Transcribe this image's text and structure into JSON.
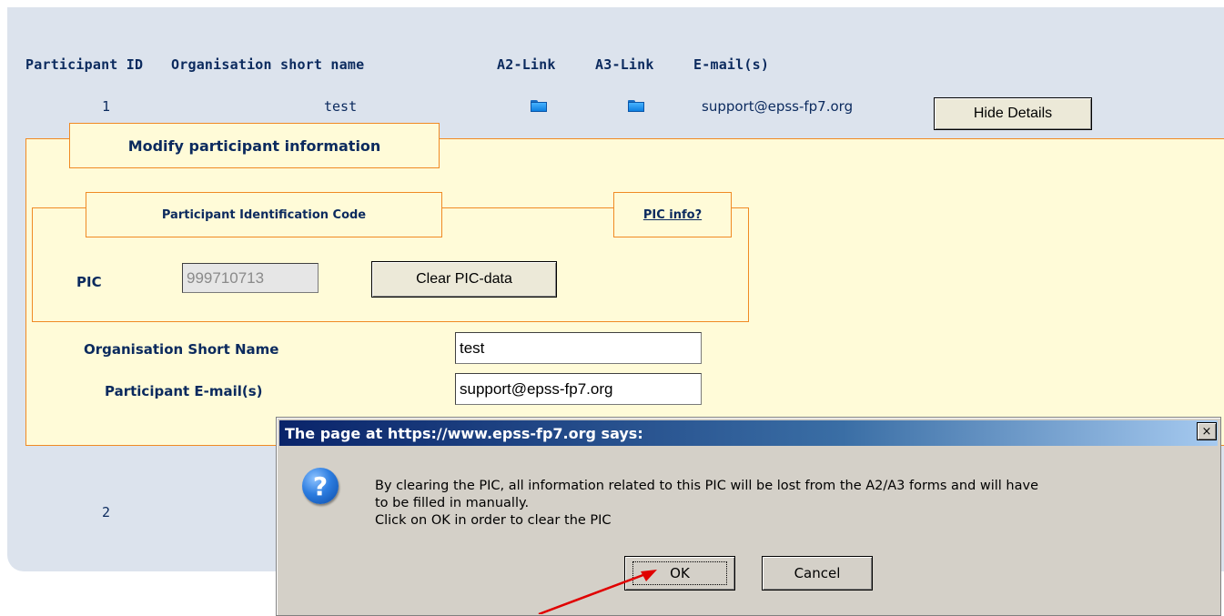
{
  "table": {
    "headers": {
      "participant_id": "Participant ID",
      "org_short_name": "Organisation short name",
      "a2_link": "A2-Link",
      "a3_link": "A3-Link",
      "emails": "E-mail(s)"
    },
    "rows": [
      {
        "id": "1",
        "org": "test",
        "email": "support@epss-fp7.org",
        "action": "Hide Details"
      },
      {
        "id": "2"
      }
    ]
  },
  "details": {
    "legend": "Modify participant information",
    "pic_section": {
      "legend": "Participant Identification Code",
      "info_link": "PIC info?",
      "pic_label": "PIC",
      "pic_value": "999710713",
      "clear_button": "Clear PIC-data"
    },
    "org_short_name_label": "Organisation Short Name",
    "org_short_name_value": "test",
    "email_label": "Participant E-mail(s)",
    "email_value": "support@epss-fp7.org"
  },
  "dialog": {
    "title": "The page at https://www.epss-fp7.org says:",
    "close": "×",
    "icon": "question-icon",
    "message_line1": "By clearing the PIC, all information related to this PIC will be lost from the A2/A3 forms and will have",
    "message_line2": "to be filled in manually.",
    "message_line3": "Click on OK in order to clear the PIC",
    "ok": "OK",
    "cancel": "Cancel"
  },
  "colors": {
    "panel": "#dce3ed",
    "details_bg": "#fffbd8",
    "border_orange": "#f08a24",
    "text_navy": "#0b2a5e",
    "arrow": "#e00000"
  }
}
